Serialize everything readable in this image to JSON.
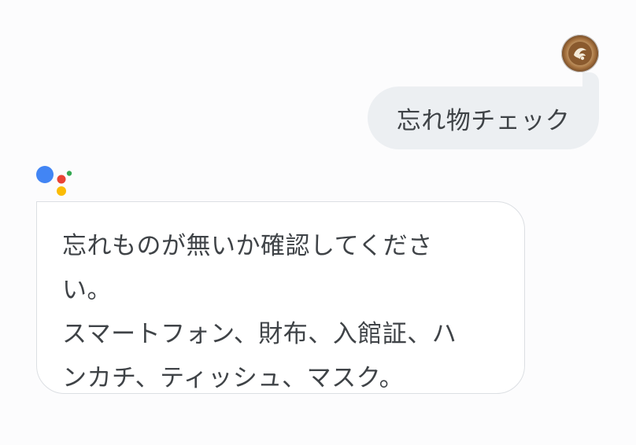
{
  "conversation": {
    "user_message": {
      "text": "忘れ物チェック",
      "avatar_icon": "latte-art-avatar"
    },
    "assistant_message": {
      "logo_icon": "google-assistant-logo",
      "text": "忘れものが無いか確認してくださ\nい。\nスマートフォン、財布、入館証、ハ\nンカチ、ティッシュ、マスク。"
    }
  },
  "colors": {
    "background": "#fcfcfd",
    "user_bubble": "#eceff2",
    "assistant_bubble_border": "#dcdfe3",
    "text": "#3f4347",
    "logo_blue": "#4285F4",
    "logo_red": "#EA4335",
    "logo_yellow": "#FBBC05",
    "logo_green": "#34A853"
  }
}
